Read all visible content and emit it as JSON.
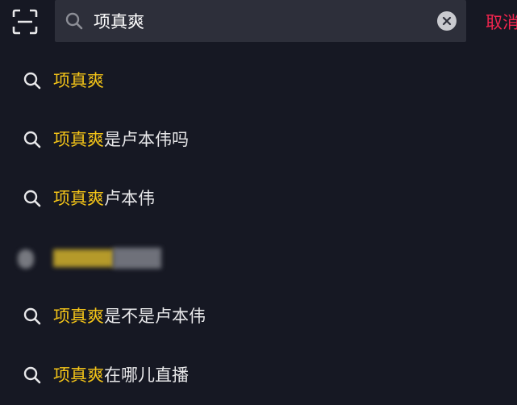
{
  "search": {
    "query": "项真爽",
    "cancel_label": "取消"
  },
  "suggestions": [
    {
      "highlight": "项真爽",
      "rest": ""
    },
    {
      "highlight": "项真爽",
      "rest": "是卢本伟吗"
    },
    {
      "highlight": "项真爽",
      "rest": "卢本伟"
    },
    {
      "redacted": true
    },
    {
      "highlight": "项真爽",
      "rest": "是不是卢本伟"
    },
    {
      "highlight": "项真爽",
      "rest": "在哪儿直播"
    }
  ],
  "colors": {
    "background": "#161823",
    "search_box": "#2d2f3a",
    "highlight": "#f5c518",
    "cancel": "#f1254e"
  },
  "icons": {
    "scan": "scan-icon",
    "search": "search-icon",
    "clear": "clear-icon"
  }
}
